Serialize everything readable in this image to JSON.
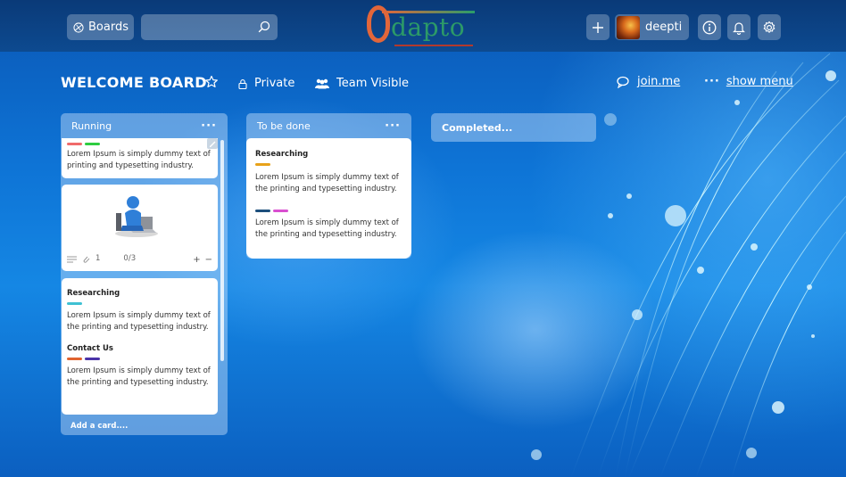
{
  "topbar": {
    "boards_label": "Boards",
    "search": {
      "value": "",
      "placeholder": ""
    },
    "logo_text": "dapto",
    "user_name": "deepti"
  },
  "board": {
    "title": "WELCOME BOARD",
    "privacy_label": "Private",
    "team_label": "Team Visible",
    "joinme_label": "join.me",
    "show_menu_label": "show menu"
  },
  "lists": [
    {
      "name": "Running",
      "add_card_label": "Add a card....",
      "cards": [
        {
          "labels": [
            "#f06b6b",
            "#2ecc40"
          ],
          "text": "Lorem Ipsum is simply dummy text of printing and typesetting industry."
        },
        {
          "image": "person-at-laptop",
          "attachments": "1",
          "checklist": "0/3"
        },
        {
          "title": "Researching",
          "labels": [
            "#3fc1d3"
          ],
          "text": "Lorem Ipsum is simply dummy text of the printing and typesetting industry.",
          "title2": "Contact Us",
          "labels2": [
            "#e0632f",
            "#4a33a8"
          ],
          "text2": "Lorem Ipsum is simply dummy text of the printing and typesetting industry."
        }
      ]
    },
    {
      "name": "To be done",
      "cards": [
        {
          "title": "Researching",
          "labels": [
            "#e8a21a"
          ],
          "text": "Lorem Ipsum is simply dummy text of the printing and typesetting industry.",
          "labels2": [
            "#1d4f7c",
            "#d94fd0"
          ],
          "text2": "Lorem Ipsum is simply dummy text of the printing and typesetting industry."
        }
      ]
    },
    {
      "name": "Completed..."
    }
  ]
}
